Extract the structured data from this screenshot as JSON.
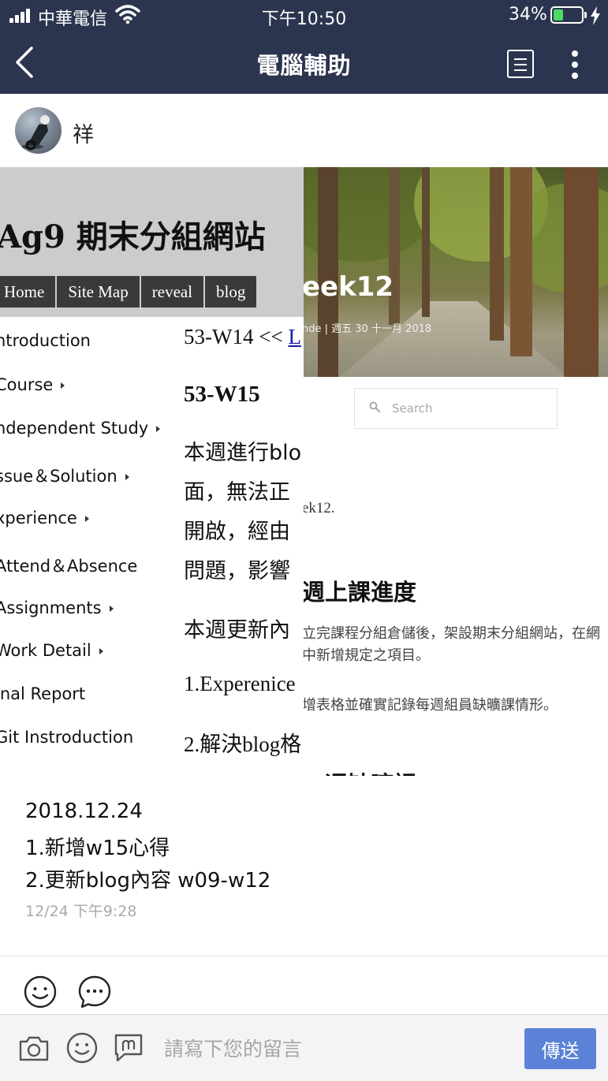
{
  "status_bar": {
    "carrier": "中華電信",
    "time": "下午10:50",
    "battery_percent": "34%",
    "battery_level": 0.34,
    "battery_color": "#4cd964"
  },
  "nav": {
    "title": "電腦輔助",
    "background": "#2c354f",
    "icons": [
      "chevron-left-icon",
      "note-icon",
      "more-vertical-icon"
    ]
  },
  "post": {
    "author": "祥",
    "left_image": {
      "site_title": "Ag9 期末分組網站",
      "nav_items": [
        "Home",
        "Site Map",
        "reveal",
        "blog"
      ],
      "menu": [
        {
          "label": "ntroduction",
          "arrow": false
        },
        {
          "label": "Course",
          "arrow": true
        },
        {
          "label": "ndependent Study",
          "arrow": true
        },
        {
          "label": "ssue＆Solution",
          "arrow": true
        },
        {
          "label": "xperience",
          "arrow": true
        },
        {
          "label": "Attend＆Absence",
          "arrow": false
        },
        {
          "label": "Assignments",
          "arrow": true
        },
        {
          "label": "Work Detail",
          "arrow": true
        },
        {
          "label": "inal Report",
          "arrow": false
        },
        {
          "label": "Git Instroduction",
          "arrow": false
        }
      ],
      "content": {
        "prev_prefix": "53-W14 << ",
        "prev_link": "L",
        "heading": "53-W15",
        "lines": [
          "本週進行blo",
          "面，無法正",
          "開啟，經由",
          "問題，影響"
        ],
        "update_line": "本週更新內",
        "item1": "1.Experenice",
        "item2": "2.解決blog格"
      }
    },
    "right_image": {
      "hero_title": "eek12",
      "hero_meta": "nde | 週五 30 十一月 2018",
      "search_placeholder": "Search",
      "line1": "ek12.",
      "heading": "週上課進度",
      "para1": "立完課程分組倉儲後，架設期末分組網站，在網",
      "para2": "中新增規定之項目。",
      "para3": "增表格並確實記錄每週組員缺曠課情形。",
      "partial_heading": "一週缺曠課"
    },
    "text": {
      "date": "2018.12.24",
      "line1": "1.新增w15心得",
      "line2": "2.更新blog內容 w09-w12"
    },
    "timestamp": "12/24 下午9:28"
  },
  "reactions": [
    "smile-icon",
    "comment-icon"
  ],
  "composer": {
    "placeholder": "請寫下您的留言",
    "send_label": "傳送",
    "send_color": "#5b82d6",
    "icons": [
      "camera-icon",
      "emoji-icon",
      "sticker-icon"
    ]
  }
}
